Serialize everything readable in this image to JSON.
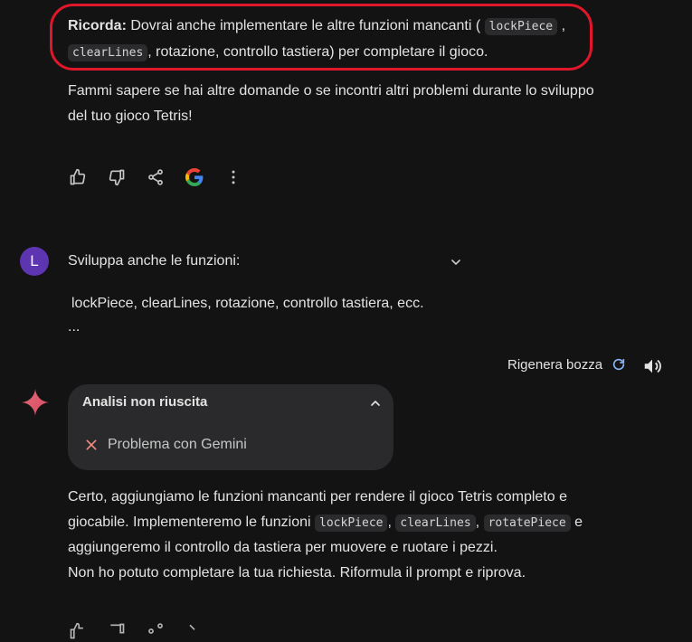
{
  "prev_response": {
    "note_bold": "Ricorda:",
    "note_text_1": " Dovrai anche implementare le altre funzioni mancanti (",
    "code_1": "lockPiece",
    "sep_1": ",",
    "code_2": "clearLines",
    "note_text_2": ", rotazione, controllo tastiera) per completare il gioco.",
    "followup_line_1": "Fammi sapere se hai altre domande o se incontri altri problemi durante lo sviluppo",
    "followup_line_2": "del tuo gioco Tetris!"
  },
  "user_prompt": {
    "avatar_letter": "L",
    "line_1": "Sviluppa anche le funzioni:",
    "line_2": "lockPiece, clearLines, rotazione, controllo tastiera, ecc.",
    "line_3": "..."
  },
  "toolbar": {
    "regenerate_label": "Rigenera bozza"
  },
  "analysis_card": {
    "title": "Analisi non riuscita",
    "error_text": "Problema con Gemini"
  },
  "response": {
    "line_1": "Certo, aggiungiamo le funzioni mancanti per rendere il gioco Tetris completo e",
    "line_2_a": "giocabile. Implementeremo le funzioni ",
    "code_a": "lockPiece",
    "sep_a": ",",
    "code_b": "clearLines",
    "sep_b": ",",
    "code_c": "rotatePiece",
    "line_2_b": " e",
    "line_3": "aggiungeremo il controllo da tastiera per muovere e ruotare i pezzi.",
    "line_4": "Non ho potuto completare la tua richiesta. Riformula il prompt e riprova."
  },
  "colors": {
    "background": "#131314",
    "highlight": "#e0162b",
    "avatar": "#5e35b1",
    "card": "#2a2a2c"
  }
}
